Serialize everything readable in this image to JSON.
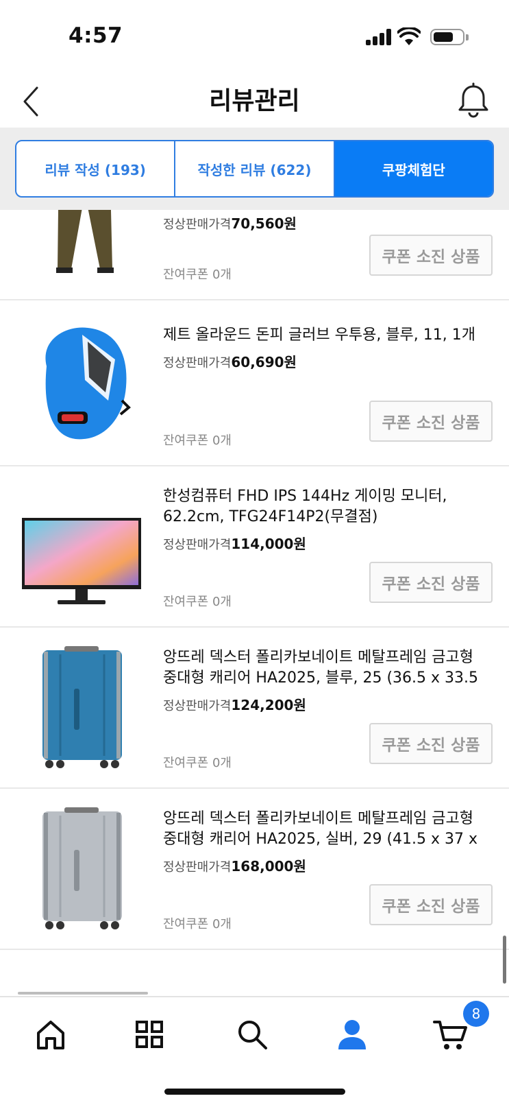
{
  "status": {
    "time": "4:57"
  },
  "header": {
    "title": "리뷰관리"
  },
  "tabs": [
    {
      "label": "리뷰 작성 (193)",
      "active": false
    },
    {
      "label": "작성한 리뷰 (622)",
      "active": false
    },
    {
      "label": "쿠팡체험단",
      "active": true
    }
  ],
  "items": [
    {
      "name": "",
      "price_label": "정상판매가격",
      "price": "70,560원",
      "coupon": "잔여쿠폰 0개",
      "button": "쿠폰 소진 상품",
      "image": "cargo-pants"
    },
    {
      "name": "제트 올라운드 돈피 글러브 우투용, 블루, 11, 1개",
      "price_label": "정상판매가격",
      "price": "60,690원",
      "coupon": "잔여쿠폰 0개",
      "button": "쿠폰 소진 상품",
      "image": "baseball-glove"
    },
    {
      "name": "한성컴퓨터 FHD IPS 144Hz 게이밍 모니터, 62.2cm, TFG24F14P2(무결점)",
      "price_label": "정상판매가격",
      "price": "114,000원",
      "coupon": "잔여쿠폰 0개",
      "button": "쿠폰 소진 상품",
      "image": "gaming-monitor"
    },
    {
      "name": "앙뜨레 덱스터 폴리카보네이트 메탈프레임 금고형 중대형 캐리어 HA2025, 블루, 25 (36.5 x 33.5",
      "price_label": "정상판매가격",
      "price": "124,200원",
      "coupon": "잔여쿠폰 0개",
      "button": "쿠폰 소진 상품",
      "image": "blue-suitcase"
    },
    {
      "name": "앙뜨레 덱스터 폴리카보네이트 메탈프레임 금고형 중대형 캐리어 HA2025, 실버, 29 (41.5 x 37 x",
      "price_label": "정상판매가격",
      "price": "168,000원",
      "coupon": "잔여쿠폰 0개",
      "button": "쿠폰 소진 상품",
      "image": "silver-suitcase"
    }
  ],
  "bottom_nav": {
    "items": [
      "home-icon",
      "grid-icon",
      "search-icon",
      "profile-icon",
      "cart-icon"
    ],
    "cart_badge": "8"
  },
  "colors": {
    "accent": "#0a7cf5",
    "tab_border": "#2f7de1",
    "badge": "#1f77ec"
  }
}
